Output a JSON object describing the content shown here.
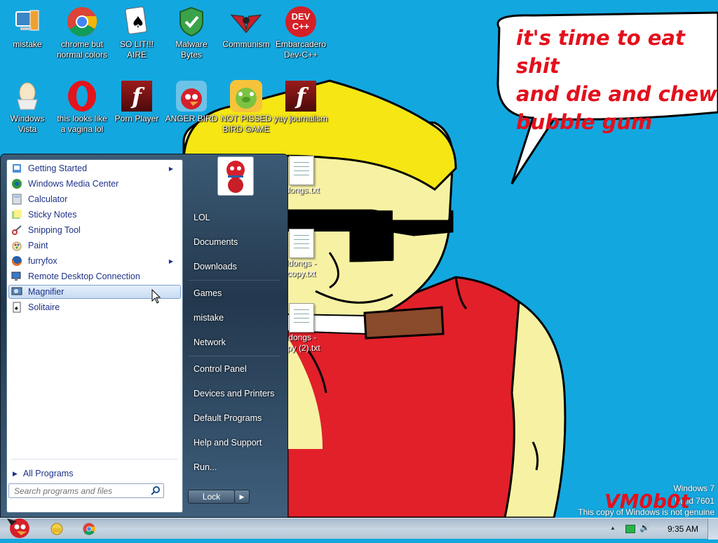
{
  "speech_bubble": {
    "text": "it's time to eat shit\nand die and chew\nbubble gum"
  },
  "desktop_icons": [
    {
      "label": "mistake",
      "icon": "computer-icon"
    },
    {
      "label": "chrome but normal colors",
      "icon": "chrome-icon"
    },
    {
      "label": "SO LIT!!! AIRE",
      "icon": "solitaire-icon"
    },
    {
      "label": "Malware Bytes",
      "icon": "shield-icon"
    },
    {
      "label": "Communism",
      "icon": "emblem-icon"
    },
    {
      "label": "Embarcadero Dev-C++",
      "icon": "devcpp-icon",
      "badge": "DEV\nC++"
    },
    {
      "label": "Windows Vista",
      "icon": "egg-icon"
    },
    {
      "label": "this looks like a vagina lol",
      "icon": "opera-icon"
    },
    {
      "label": "Porn Player",
      "icon": "flash-icon",
      "glyph": "f"
    },
    {
      "label": "ANGER BIRD",
      "icon": "angry-bird-icon"
    },
    {
      "label": "NOT PISSED BIRD GAME",
      "icon": "green-pig-icon"
    },
    {
      "label": "yay journalism",
      "icon": "flash-icon",
      "glyph": "f"
    }
  ],
  "desktop_files": [
    {
      "label": "ldongs.txt"
    },
    {
      "label": "ldongs -\ncopy.txt"
    },
    {
      "label": "ldongs -\nopy (2).txt"
    }
  ],
  "start_menu": {
    "programs": [
      {
        "label": "Getting Started",
        "icon": "getting-started-icon",
        "has_submenu": true
      },
      {
        "label": "Windows Media Center",
        "icon": "media-center-icon",
        "has_submenu": false
      },
      {
        "label": "Calculator",
        "icon": "calculator-icon",
        "has_submenu": false
      },
      {
        "label": "Sticky Notes",
        "icon": "sticky-notes-icon",
        "has_submenu": false
      },
      {
        "label": "Snipping Tool",
        "icon": "snipping-tool-icon",
        "has_submenu": false
      },
      {
        "label": "Paint",
        "icon": "paint-icon",
        "has_submenu": false
      },
      {
        "label": "furryfox",
        "icon": "firefox-icon",
        "has_submenu": true
      },
      {
        "label": "Remote Desktop Connection",
        "icon": "remote-desktop-icon",
        "has_submenu": false
      },
      {
        "label": "Magnifier",
        "icon": "magnifier-icon",
        "has_submenu": false,
        "selected": true
      },
      {
        "label": "Solitaire",
        "icon": "solitaire-icon",
        "has_submenu": false
      }
    ],
    "all_programs": "All Programs",
    "search_placeholder": "Search programs and files",
    "right_links": [
      "LOL",
      "Documents",
      "Downloads",
      "Games",
      "mistake",
      "Network",
      "Control Panel",
      "Devices and Printers",
      "Default Programs",
      "Help and Support",
      "Run..."
    ],
    "lock_label": "Lock",
    "arrow_glyph": "▶"
  },
  "watermark": {
    "line1": "Windows 7",
    "line2": "Build 7601",
    "line3": "This copy of Windows is not genuine",
    "overlay": "VM0b0t"
  },
  "taskbar": {
    "clock": "9:35 AM",
    "tray_up": "▲",
    "tray_speaker": "🔊"
  },
  "colors": {
    "desktop": "#13a7e0",
    "hair": "#f5e614",
    "skin": "#f7f2a3",
    "shirt": "#e1202a",
    "speech_text": "#e3101c"
  }
}
